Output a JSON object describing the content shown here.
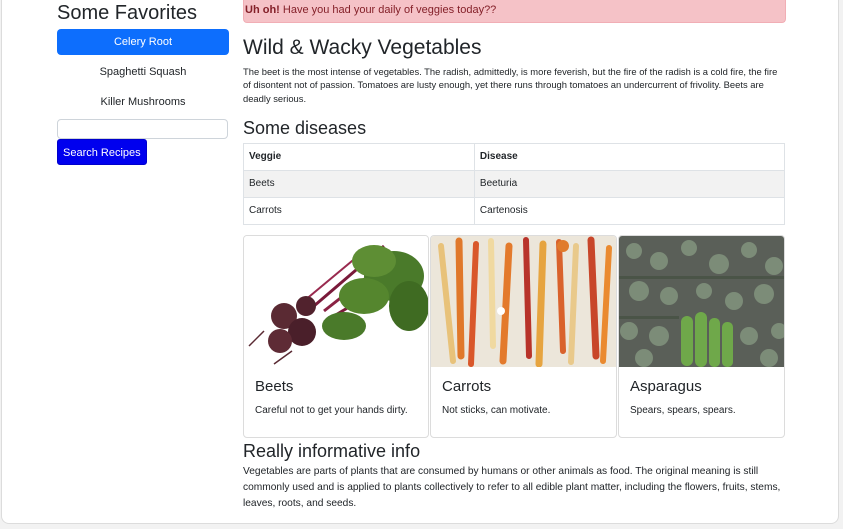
{
  "sidebar": {
    "title": "Some Favorites",
    "items": [
      {
        "label": "Celery Root"
      },
      {
        "label": "Spaghetti Squash"
      },
      {
        "label": "Killer Mushrooms"
      }
    ],
    "search_value": "",
    "search_button": "Search Recipes"
  },
  "alert": {
    "strong": "Uh oh!",
    "text": " Have you had your daily of veggies today??"
  },
  "main": {
    "title": "Wild & Wacky Vegetables",
    "intro": "The beet is the most intense of vegetables. The radish, admittedly, is more feverish, but the fire of the radish is a cold fire, the fire of disontent not of passion. Tomatoes are lusty enough, yet there runs through tomatoes an undercurrent of frivolity. Beets are deadly serious.",
    "diseases_heading": "Some diseases",
    "table": {
      "headers": [
        "Veggie",
        "Disease"
      ],
      "rows": [
        [
          "Beets",
          "Beeturia"
        ],
        [
          "Carrots",
          "Cartenosis"
        ]
      ]
    },
    "cards": [
      {
        "title": "Beets",
        "text": "Careful not to get your hands dirty."
      },
      {
        "title": "Carrots",
        "text": "Not sticks, can motivate."
      },
      {
        "title": "Asparagus",
        "text": "Spears, spears, spears."
      }
    ],
    "info_heading": "Really informative info",
    "info_text": "Vegetables are parts of plants that are consumed by humans or other animals as food. The original meaning is still commonly used and is applied to plants collectively to refer to all edible plant matter, including the flowers, fruits, stems, leaves, roots, and seeds."
  }
}
